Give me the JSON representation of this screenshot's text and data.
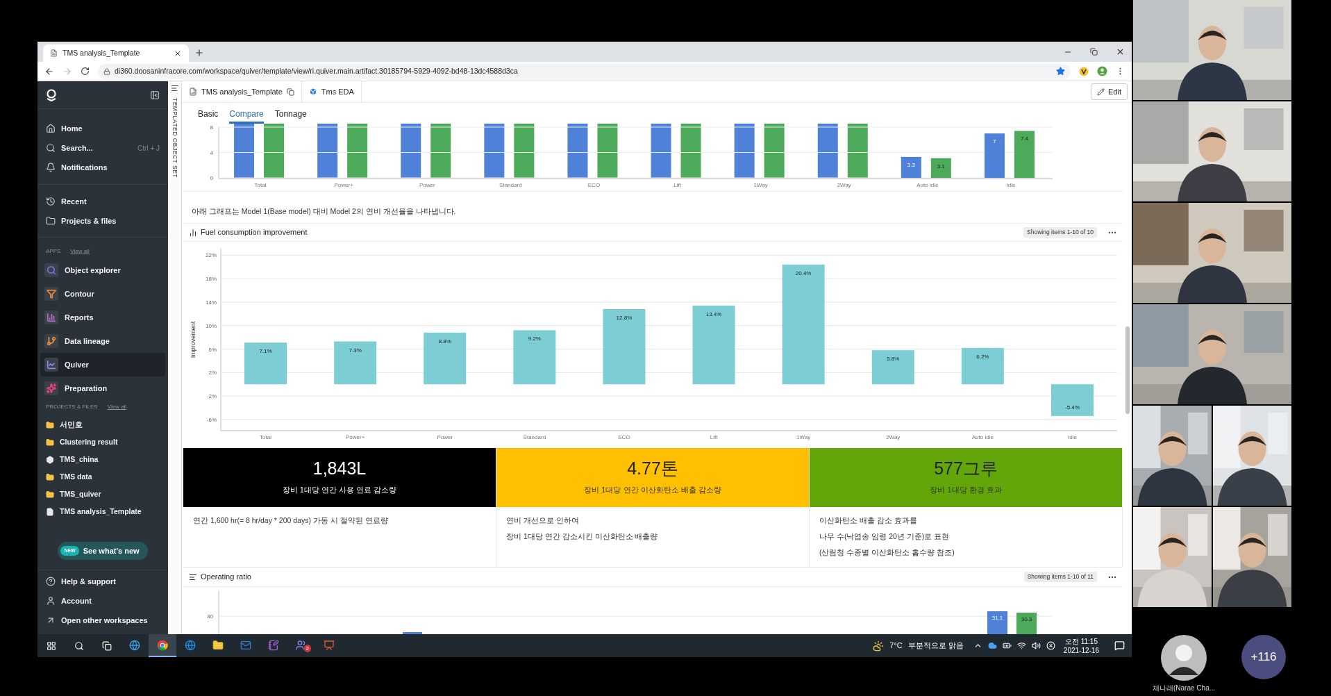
{
  "browser": {
    "tab_title": "TMS analysis_Template",
    "url": "di360.doosaninfracore.com/workspace/quiver/template/view/ri.quiver.main.artifact.30185794-5929-4092-bd48-13dc4588d3ca"
  },
  "sidebar": {
    "nav": [
      {
        "label": "Home",
        "kind": "home"
      },
      {
        "label": "Search...",
        "shortcut": "Ctrl + J",
        "kind": "search"
      },
      {
        "label": "Notifications",
        "kind": "bell"
      }
    ],
    "nav2": [
      {
        "label": "Recent",
        "kind": "recent"
      },
      {
        "label": "Projects & files",
        "kind": "folder"
      }
    ],
    "apps_heading": "APPS",
    "apps_link": "View all",
    "apps": [
      {
        "label": "Object explorer",
        "kind": "search",
        "color": "#7c6fe0",
        "selected": false
      },
      {
        "label": "Contour",
        "kind": "funnel",
        "color": "#e8873a",
        "selected": false
      },
      {
        "label": "Reports",
        "kind": "bars",
        "color": "#b46ac8",
        "selected": false
      },
      {
        "label": "Data lineage",
        "kind": "lineage",
        "color": "#f08a3c",
        "selected": false
      },
      {
        "label": "Quiver",
        "kind": "line",
        "color": "#8d86e6",
        "selected": true
      },
      {
        "label": "Preparation",
        "kind": "sparkles",
        "color": "#e8457a",
        "selected": false
      }
    ],
    "projects_heading": "PROJECTS & FILES",
    "projects_link": "View all",
    "projects": [
      {
        "label": "서민호",
        "kind": "folder"
      },
      {
        "label": "Clustering result",
        "kind": "folder"
      },
      {
        "label": "TMS_china",
        "kind": "box"
      },
      {
        "label": "TMS data",
        "kind": "folder"
      },
      {
        "label": "TMS_quiver",
        "kind": "folder"
      },
      {
        "label": "TMS analysis_Template",
        "kind": "file"
      }
    ],
    "new_badge": "NEW",
    "whats_new": "See what's new",
    "footer": [
      {
        "label": "Help & support",
        "kind": "help"
      },
      {
        "label": "Account",
        "kind": "account"
      },
      {
        "label": "Open other workspaces",
        "kind": "arrow"
      }
    ]
  },
  "side_strip": "TEMPLATED OBJECT SET",
  "doc_tabs": [
    {
      "label": "TMS analysis_Template",
      "kind": "template"
    },
    {
      "label": "Tms EDA",
      "kind": "eda"
    }
  ],
  "edit_button": "Edit",
  "view_tabs": [
    {
      "label": "Basic",
      "selected": false
    },
    {
      "label": "Compare",
      "selected": true
    },
    {
      "label": "Tonnage",
      "selected": false
    }
  ],
  "top_chart": {
    "chart_data": {
      "type": "bar",
      "categories": [
        "Total",
        "Power+",
        "Power",
        "Standard",
        "ECO",
        "Lift",
        "1Way",
        "2Way",
        "Auto idle",
        "Idle"
      ],
      "ylim": [
        0,
        8
      ],
      "yticks": [
        0,
        4,
        8
      ],
      "grid": true,
      "data_labels": true,
      "series": [
        {
          "color": "#4f81d9",
          "values": [
            null,
            null,
            null,
            null,
            null,
            null,
            null,
            null,
            3.3,
            7
          ]
        },
        {
          "color": "#4caa5a",
          "values": [
            null,
            null,
            null,
            null,
            null,
            null,
            null,
            null,
            3.1,
            7.4
          ]
        }
      ]
    }
  },
  "note": "아래 그래프는 Model 1(Base model) 대비 Model 2의 연비 개선율을 나타냅니다.",
  "fuel": {
    "title": "Fuel consumption improvement",
    "showing": "Showing items 1-10 of 10",
    "chart_data": {
      "type": "bar",
      "ylabel": "Improvement",
      "categories": [
        "Total",
        "Power+",
        "Power",
        "Standard",
        "ECO",
        "Lift",
        "1Way",
        "2Way",
        "Auto idle",
        "Idle"
      ],
      "ylim": [
        -7.9,
        23.1
      ],
      "grid": true,
      "yticks": [
        {
          "value": -6,
          "label": "-6%"
        },
        {
          "value": -2,
          "label": "-2%"
        },
        {
          "value": 2,
          "label": "2%"
        },
        {
          "value": 6,
          "label": "6%"
        },
        {
          "value": 10,
          "label": "10%"
        },
        {
          "value": 14,
          "label": "14%"
        },
        {
          "value": 18,
          "label": "18%"
        },
        {
          "value": 22,
          "label": "22%"
        }
      ],
      "series": [
        {
          "color": "#7ccdd4",
          "values": [
            7.1,
            7.3,
            8.8,
            9.2,
            12.8,
            13.4,
            20.4,
            5.8,
            6.2,
            -5.4
          ]
        }
      ],
      "value_labels": [
        "7.1%",
        "7.3%",
        "8.8%",
        "9.2%",
        "12.8%",
        "13.4%",
        "20.4%",
        "5.8%",
        "6.2%",
        "-5.4%"
      ]
    }
  },
  "kpis": [
    {
      "value": "1,843L",
      "caption": "장비 1대당 연간 사용 연료 감소량",
      "color": "#000000",
      "notes": [
        "연간 1,600 hr(= 8 hr/day * 200 days) 가동 시 절약된 연료량"
      ]
    },
    {
      "value": "4.77톤",
      "caption": "장비 1대당 연간 이산화탄소 배출 감소량",
      "color": "#ffc000",
      "notes": [
        "연비 개선으로 인하여",
        "장비 1대당 연간 감소시킨 이산화탄소 배출량"
      ]
    },
    {
      "value": "577그루",
      "caption": "장비 1대당 환경 효과",
      "color": "#63a60a",
      "notes": [
        "이산화탄소 배출 감소 효과를",
        "나무 수(낙엽송 임령 20년 기준)로 표현",
        "(산림청 수종별 이산화탄소 흡수량 참조)"
      ]
    }
  ],
  "operating": {
    "title": "Operating ratio",
    "showing": "Showing items 1-10 of 11",
    "ytick": "30",
    "bar_labels": [
      "31.1",
      "30.3"
    ]
  },
  "taskbar": {
    "apps": [
      {
        "kind": "edge",
        "selected": false
      },
      {
        "kind": "chrome",
        "selected": true
      },
      {
        "kind": "ie",
        "selected": false
      },
      {
        "kind": "explorer",
        "selected": false
      },
      {
        "kind": "outlook",
        "selected": false
      },
      {
        "kind": "onenote",
        "selected": false
      },
      {
        "kind": "teams",
        "selected": false,
        "badge": "2"
      },
      {
        "kind": "powerpoint",
        "selected": false
      }
    ],
    "temperature": "7°C",
    "weather": "부분적으로 맑음",
    "time": "오전 11:15",
    "date": "2021-12-16"
  },
  "call": {
    "self_name": "채나래(Narae Cha...",
    "more": "+116"
  }
}
